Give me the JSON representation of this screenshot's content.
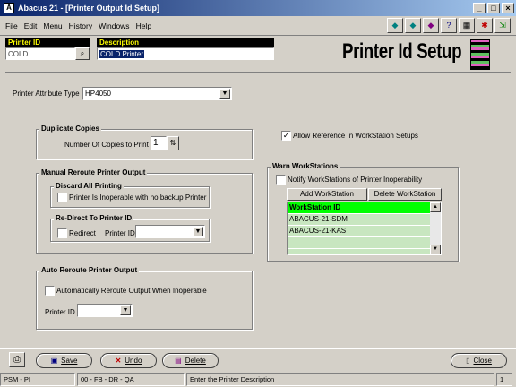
{
  "window": {
    "title": "Abacus 21 - [Printer Output Id Setup]",
    "controls": [
      "_",
      "□",
      "×"
    ]
  },
  "menu": [
    "File",
    "Edit",
    "Menu",
    "History",
    "Windows",
    "Help"
  ],
  "toolbar_icons": [
    "arrow-left-icon",
    "arrow-right-icon",
    "gem-icon",
    "question-icon",
    "calculator-icon",
    "help-person-icon",
    "exit-icon"
  ],
  "header": {
    "printer_id_label": "Printer ID",
    "printer_id_value": "COLD",
    "description_label": "Description",
    "description_value": "COLD Printer",
    "page_title": "Printer Id Setup"
  },
  "form": {
    "attr_type_label": "Printer Attribute Type",
    "attr_type_value": "HP4050",
    "duplicate": {
      "title": "Duplicate Copies",
      "copies_label": "Number Of Copies to Print",
      "copies_value": "1"
    },
    "allow_ref_label": "Allow Reference In WorkStation Setups",
    "allow_ref_checked": "✓",
    "manual": {
      "title": "Manual Reroute Printer Output",
      "discard_title": "Discard All Printing",
      "inoperable_label": "Printer Is Inoperable with no backup Printer",
      "redirect_title": "Re-Direct To Printer ID",
      "redirect_label": "Redirect",
      "printer_id_label": "Printer ID",
      "printer_id_value": ""
    },
    "auto": {
      "title": "Auto Reroute Printer Output",
      "auto_label": "Automatically Reroute Output When Inoperable",
      "printer_id_label": "Printer ID",
      "printer_id_value": ""
    },
    "warn": {
      "title": "Warn WorkStations",
      "notify_label": "Notify WorkStations of Printer Inoperability",
      "add_btn": "Add WorkStation",
      "delete_btn": "Delete WorkStation",
      "list_header": "WorkStation ID",
      "rows": [
        "ABACUS-21-SDM",
        "ABACUS-21-KAS",
        ""
      ]
    }
  },
  "buttons": {
    "save": "Save",
    "undo": "Undo",
    "delete": "Delete",
    "close": "Close"
  },
  "status": {
    "cell1": "PSM - PI",
    "cell2": "00 - FB - DR - QA",
    "cell3": "Enter the Printer Description",
    "cell4": "1"
  },
  "colors": {
    "header_label_bg": "#000000",
    "header_label_fg": "#ffff00",
    "list_header_bg": "#00ff00",
    "list_bg": "#c8e6c0"
  }
}
